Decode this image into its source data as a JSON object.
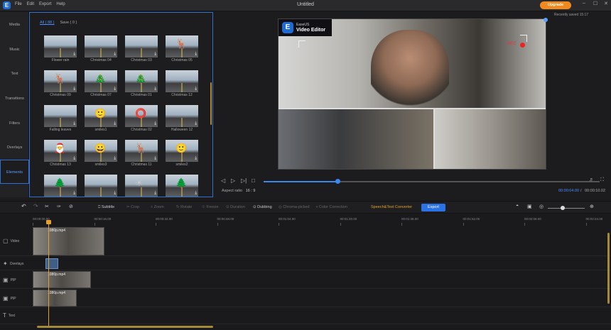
{
  "app": {
    "title": "Untitled",
    "menu": [
      "File",
      "Edit",
      "Export",
      "Help"
    ],
    "upgrade_label": "Upgrade",
    "saved_status": "Recently saved 15:17",
    "logo_glyph": "E",
    "window_controls": [
      "–",
      "☐",
      "✕"
    ]
  },
  "left_tabs": [
    {
      "label": "Media",
      "active": false
    },
    {
      "label": "Music",
      "active": false
    },
    {
      "label": "Text",
      "active": false
    },
    {
      "label": "Transitions",
      "active": false
    },
    {
      "label": "Filters",
      "active": false
    },
    {
      "label": "Overlays",
      "active": false
    },
    {
      "label": "Elements",
      "active": true
    }
  ],
  "library": {
    "filters": [
      "All ( 88 )",
      "Save ( 0 )"
    ],
    "items": [
      {
        "label": "Flower rain",
        "deco": ""
      },
      {
        "label": "Christmas 04",
        "deco": ""
      },
      {
        "label": "Christmas 03",
        "deco": ""
      },
      {
        "label": "Christmas 05",
        "deco": "🦌"
      },
      {
        "label": "Christmas 09",
        "deco": "🦌"
      },
      {
        "label": "Christmas 07",
        "deco": "🎄"
      },
      {
        "label": "Christmas 01",
        "deco": "🎄"
      },
      {
        "label": "Christmas 12",
        "deco": ""
      },
      {
        "label": "Falling leaves",
        "deco": ""
      },
      {
        "label": "smiles1",
        "deco": "🙂"
      },
      {
        "label": "Christmas 02",
        "deco": "⭕"
      },
      {
        "label": "Halloween 12",
        "deco": ""
      },
      {
        "label": "Christmas 13",
        "deco": "🎅"
      },
      {
        "label": "smiles3",
        "deco": "😀"
      },
      {
        "label": "Christmas 11",
        "deco": "🦌"
      },
      {
        "label": "smiles2",
        "deco": "🙂"
      },
      {
        "label": "",
        "deco": "🌲"
      },
      {
        "label": "",
        "deco": ""
      },
      {
        "label": "",
        "deco": "☀"
      },
      {
        "label": "",
        "deco": "🌲"
      }
    ]
  },
  "preview": {
    "watermark_line1": "EaseUS",
    "watermark_line2": "Video Editor",
    "rec_label": "REC",
    "aspect_label": "Aspect ratio",
    "aspect_value": "16 : 9",
    "current_time": "00:00:04.00",
    "separator": "/",
    "total_time": "00:00:10.02",
    "progress": 0.22,
    "controls": [
      "◁",
      "▷",
      "▷|",
      "□"
    ]
  },
  "toolbar": {
    "items": [
      {
        "label": "↶",
        "on": true
      },
      {
        "label": "↷",
        "on": false
      },
      {
        "label": "✂",
        "on": true
      },
      {
        "label": "✑",
        "on": true
      },
      {
        "label": "⊘",
        "on": true
      },
      {
        "label": "⎕ Subtitle",
        "on": true
      },
      {
        "label": "✂ Crop",
        "on": false
      },
      {
        "label": "⌕ Zoom",
        "on": false
      },
      {
        "label": "↻ Rotate",
        "on": false
      },
      {
        "label": "☉ Freeze",
        "on": false
      },
      {
        "label": "⊙ Duration",
        "on": false
      },
      {
        "label": "⊙ Dubbing",
        "on": true
      },
      {
        "label": "◎ Chroma-picked",
        "on": false
      },
      {
        "label": "◑ Color Correction",
        "on": false
      },
      {
        "label": "Speech&Text Converter",
        "speech": true
      }
    ],
    "export_label": "Export",
    "right_icons": [
      "◓",
      "▣",
      "◎"
    ]
  },
  "timeline": {
    "ruler": [
      "00:00:00.00",
      "00:00:16.00",
      "00:00:32.00",
      "00:00:48.00",
      "00:01:04.00",
      "00:01:20.00",
      "00:01:36.00",
      "00:01:52.00",
      "00:02:08.00",
      "00:02:24.00"
    ],
    "tracks": [
      {
        "label": "Video",
        "icon": "▢"
      },
      {
        "label": "Overlays",
        "icon": "✦"
      },
      {
        "label": "PIP",
        "icon": "▣"
      },
      {
        "label": "PIP",
        "icon": "▣"
      },
      {
        "label": "Text",
        "icon": "T"
      }
    ],
    "clips": {
      "video": "1080p.mp4",
      "pip1": "1080p.mp4",
      "pip2": "1080p.mp4"
    }
  }
}
